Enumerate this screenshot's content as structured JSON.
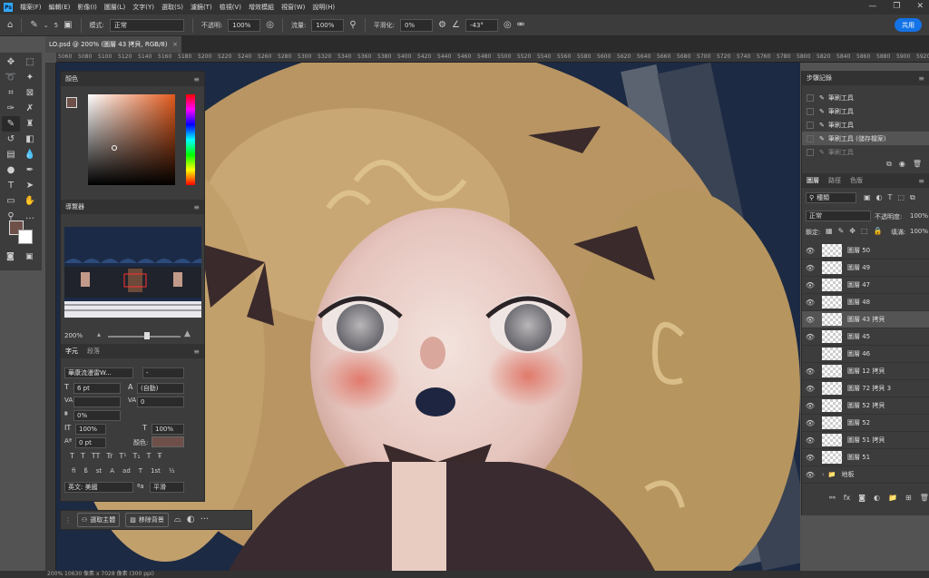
{
  "menu": {
    "items": [
      "檔案(F)",
      "編輯(E)",
      "影像(I)",
      "圖層(L)",
      "文字(Y)",
      "選取(S)",
      "濾鏡(T)",
      "檢視(V)",
      "增效模組",
      "視窗(W)",
      "說明(H)"
    ]
  },
  "options": {
    "brush_size": "5",
    "mode_label": "模式:",
    "mode_value": "正常",
    "opacity_label": "不透明:",
    "opacity_value": "100%",
    "flow_label": "流量:",
    "flow_value": "100%",
    "smooth_label": "平滑化:",
    "smooth_value": "0%",
    "angle_value": "-43°",
    "share_label": "共用"
  },
  "document": {
    "tab_title": "LO.psd @ 200% (圖層 43 拷貝, RGB/8)",
    "status": "200%    10630 像素 x 7028 像素 (300 ppi)"
  },
  "ruler": {
    "ticks": [
      "5060",
      "5080",
      "5100",
      "5120",
      "5140",
      "5160",
      "5180",
      "5200",
      "5220",
      "5240",
      "5260",
      "5280",
      "5300",
      "5320",
      "5340",
      "5360",
      "5380",
      "5400",
      "5420",
      "5440",
      "5460",
      "5480",
      "5500",
      "5520",
      "5540",
      "5560",
      "5580",
      "5600",
      "5620",
      "5640",
      "5660",
      "5680",
      "5700",
      "5720",
      "5740",
      "5760",
      "5780",
      "5800",
      "5820",
      "5840",
      "5860",
      "5880",
      "5900",
      "5920",
      "5940"
    ]
  },
  "color_panel": {
    "title": "顏色",
    "foreground": "#6e5049",
    "background": "#ffffff",
    "hue": "#e25a1c"
  },
  "navigator": {
    "title": "導覽器",
    "zoom": "200%"
  },
  "character": {
    "tab_char": "字元",
    "tab_para": "段落",
    "font_family": "華康流漫雷W...",
    "font_style": "-",
    "size": "6 pt",
    "leading": "(自動)",
    "kerning": "",
    "tracking": "0",
    "scale_pct": "0%",
    "vscale": "100%",
    "hscale": "100%",
    "baseline": "0 pt",
    "color_label": "顏色:",
    "color": "#6e5049",
    "language": "英文: 美國",
    "antialias": "平滑"
  },
  "context_bar": {
    "select_subject": "選取主體",
    "remove_bg": "移除背景"
  },
  "history": {
    "title": "步驟記錄",
    "items": [
      "筆刷工具",
      "筆刷工具",
      "筆刷工具",
      "筆刷工具 (儲存檔案)",
      "筆刷工具"
    ]
  },
  "layers": {
    "tabs": [
      "圖層",
      "路徑",
      "色版"
    ],
    "filter_label": "種類",
    "blend": "正常",
    "opacity_label": "不透明度:",
    "opacity": "100%",
    "lock_label": "鎖定:",
    "fill_label": "填滿:",
    "fill": "100%",
    "items": [
      "圖層 50",
      "圖層 49",
      "圖層 47",
      "圖層 48",
      "圖層 43 拷貝",
      "圖層 45",
      "圖層 46",
      "圖層 12 拷貝",
      "圖層 72 拷貝 3",
      "圖層 52 拷貝",
      "圖層 52",
      "圖層 51 拷貝",
      "圖層 51",
      "背景"
    ],
    "group_name": "地板"
  }
}
